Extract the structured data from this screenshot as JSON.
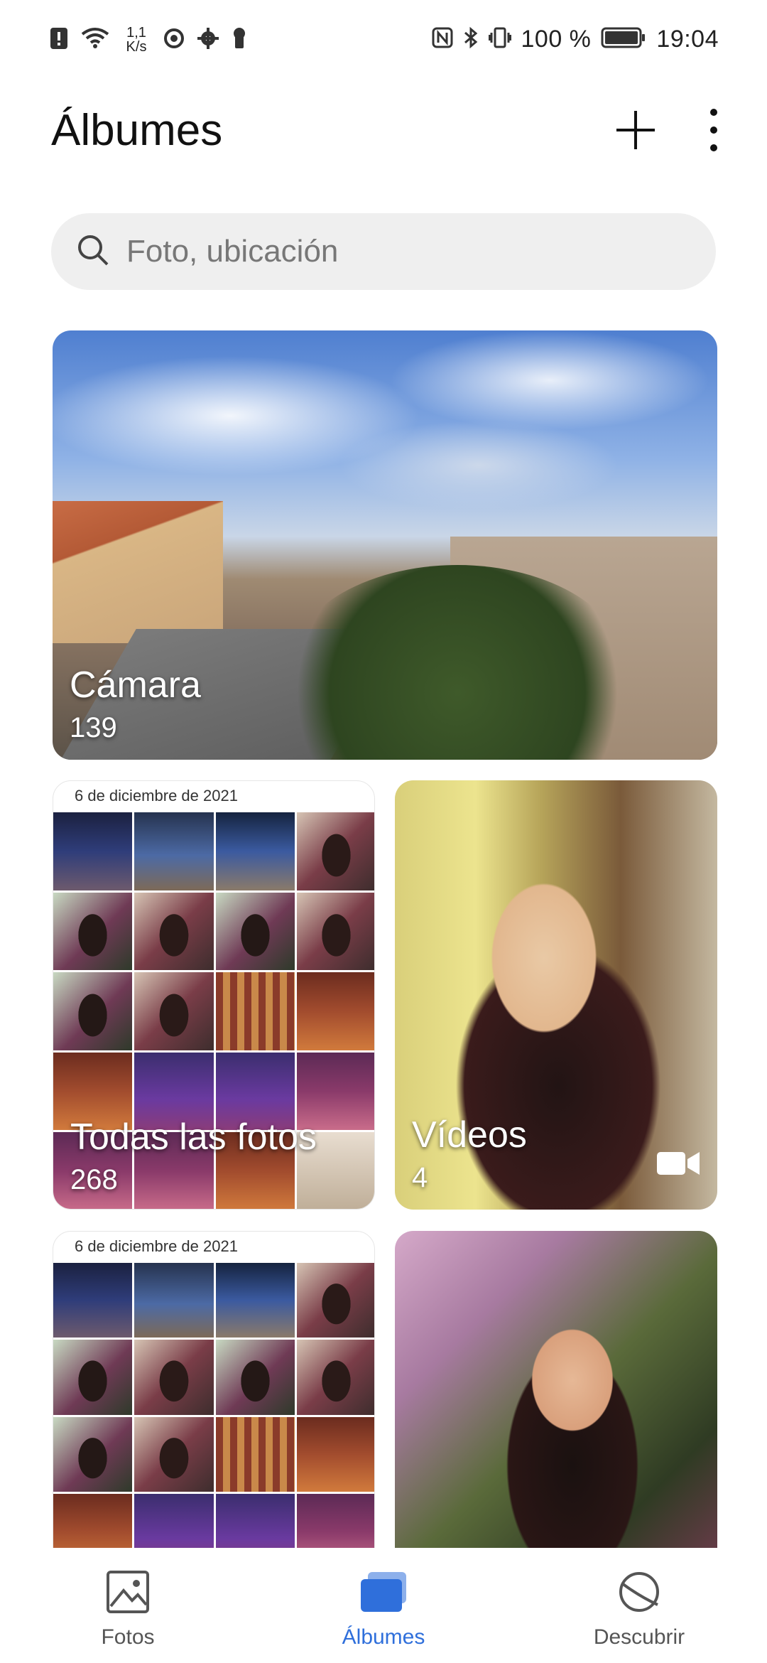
{
  "status_bar": {
    "speed_value": "1,1",
    "speed_unit": "K/s",
    "battery": "100 %",
    "time": "19:04",
    "icons": [
      "alert-icon",
      "wifi-icon",
      "vpn-icon",
      "settings-icon",
      "lock-icon",
      "nfc-icon",
      "bluetooth-icon",
      "vibrate-icon",
      "battery-icon"
    ]
  },
  "header": {
    "title": "Álbumes",
    "add_icon": "plus-icon",
    "menu_icon": "more-vert-icon"
  },
  "search": {
    "placeholder": "Foto, ubicación",
    "value": ""
  },
  "albums": [
    {
      "name": "Cámara",
      "count": "139"
    },
    {
      "date": "6 de diciembre de 2021",
      "name": "Todas las fotos",
      "count": "268"
    },
    {
      "name": "Vídeos",
      "count": "4",
      "icon": "video-icon"
    },
    {
      "date": "6 de diciembre de 2021"
    }
  ],
  "colors": {
    "accent": "#2f6fdb",
    "nav_inactive": "#555555",
    "search_bg": "#efefef"
  },
  "bottom_nav": {
    "items": [
      {
        "label": "Fotos",
        "icon": "image-icon",
        "active": false
      },
      {
        "label": "Álbumes",
        "icon": "albums-icon",
        "active": true
      },
      {
        "label": "Descubrir",
        "icon": "discover-icon",
        "active": false
      }
    ]
  }
}
